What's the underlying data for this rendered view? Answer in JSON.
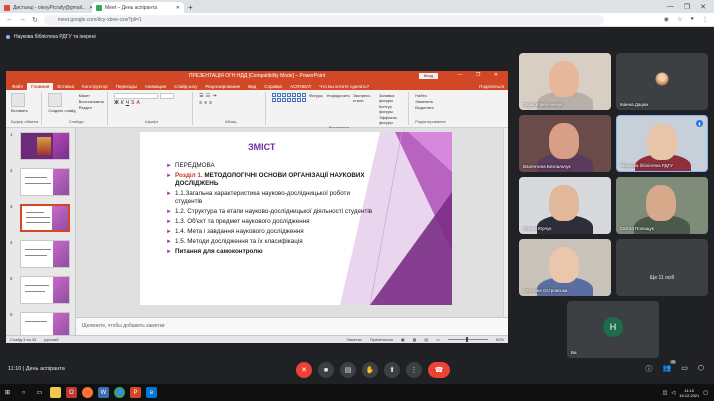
{
  "browser": {
    "tabs": [
      {
        "label": "Дистанці - olesyPicrafy@gmail...",
        "favicon_color": "#ea4335"
      },
      {
        "label": "Meet – День аспіранта",
        "favicon_color": "#34a853"
      }
    ],
    "url": "meet.google.com/dcy-xbne-czw?pli=1"
  },
  "meet": {
    "banner": "Наукова бібліотека РДГУ та інерені",
    "time": "11:10",
    "meeting_name": "День аспіранта"
  },
  "ppt": {
    "title": "ПРЕЗЕНТАЦІЯ ОГН НДД [Compatibility Mode] – PowerPoint",
    "login": "Вход",
    "menu": [
      "Файл",
      "Главная",
      "Вставка",
      "Конструктор",
      "Переходы",
      "Анимация",
      "Слайд-шоу",
      "Рецензирование",
      "Вид",
      "Справка",
      "ACROBAT",
      "Что вы хотите сделать?"
    ],
    "share": "Поделиться",
    "ribbon_groups": {
      "clipboard": {
        "name": "Буфер обмена",
        "paste": "Вставить"
      },
      "slides": {
        "name": "Слайды",
        "new": "Создать слайд",
        "layout": "Макет",
        "reset": "Восстановить",
        "section": "Раздел"
      },
      "font": {
        "name": "Шрифт"
      },
      "paragraph": {
        "name": "Абзац"
      },
      "drawing": {
        "name": "Рисование",
        "shapes": "Фигуры",
        "arrange": "Упорядочить",
        "styles": "Экспресс-стили",
        "fill": "Заливка фигуры",
        "outline": "Контур фигуры",
        "effects": "Эффекты фигуры"
      },
      "editing": {
        "name": "Редактирование",
        "find": "Найти",
        "replace": "Заменить",
        "select": "Выделить"
      }
    },
    "thumb_numbers": [
      "1",
      "2",
      "3",
      "4",
      "5",
      "6"
    ],
    "slide": {
      "heading": "ЗМІСТ",
      "items": [
        {
          "text": "ПЕРЕДМОВА",
          "style": "normal"
        },
        {
          "prefix": "Розділ 1.",
          "text": " МЕТОДОЛОГІЧНІ ОСНОВИ ОРГАНІЗАЦІЇ НАУКОВИХ ДОСЛІДЖЕНЬ",
          "style": "section"
        },
        {
          "text": "1.1.Загальна характеристика науково-дослідницької роботи студентів",
          "style": "normal"
        },
        {
          "text": "1.2. Структура та етапи науково-дослідницької діяльності студентів",
          "style": "normal"
        },
        {
          "text": "1.3. Об'єкт та предмет наукового дослідження",
          "style": "normal"
        },
        {
          "text": "1.4. Мета і завдання наукового дослідження",
          "style": "normal"
        },
        {
          "text": "1.5. Методи дослідження та їх класифікація",
          "style": "normal"
        },
        {
          "text": "Питання для самоконтролю",
          "style": "bold"
        }
      ]
    },
    "notes_placeholder": "Щелкните, чтобы добавить заметки",
    "status": {
      "slide": "Слайд 3 из 43",
      "lang": "русский",
      "notes": "Заметки",
      "comments": "Примечания",
      "zoom": "62%"
    }
  },
  "participants": [
    {
      "name": "Лариса Мельничук",
      "skin": "#e6b79a",
      "body": "#b8b0a8",
      "bg": "#d8cfc4"
    },
    {
      "name": "Іванна Дацюк",
      "type": "avatar-photo",
      "bg": "#3c4043"
    },
    {
      "name": "Валентина Безпальчук",
      "skin": "#d99f86",
      "body": "#5b3a5e",
      "bg": "#6b4a4a"
    },
    {
      "name": "Наукова бібліотека РДГУ",
      "skin": "#e8c4a8",
      "body": "#8e2f3c",
      "bg": "#c7d0d8",
      "active": true
    },
    {
      "name": "Олена Юрчук",
      "skin": "#e2b89a",
      "body": "#2e2e3a",
      "bg": "#d7d9dc"
    },
    {
      "name": "Світла Полищук",
      "skin": "#d6a98a",
      "body": "#4a5a4a",
      "bg": "#7f8c7a"
    },
    {
      "name": "Світлана Островська",
      "skin": "#eac6ac",
      "body": "#5a6ea0",
      "bg": "#c9c2b8"
    },
    {
      "name": "Ще 11 осіб",
      "type": "more"
    },
    {
      "name": "Ви",
      "type": "self",
      "initial": "Н"
    }
  ],
  "taskbar": {
    "time": "11:10",
    "date": "16.12.2021",
    "count": "20"
  }
}
